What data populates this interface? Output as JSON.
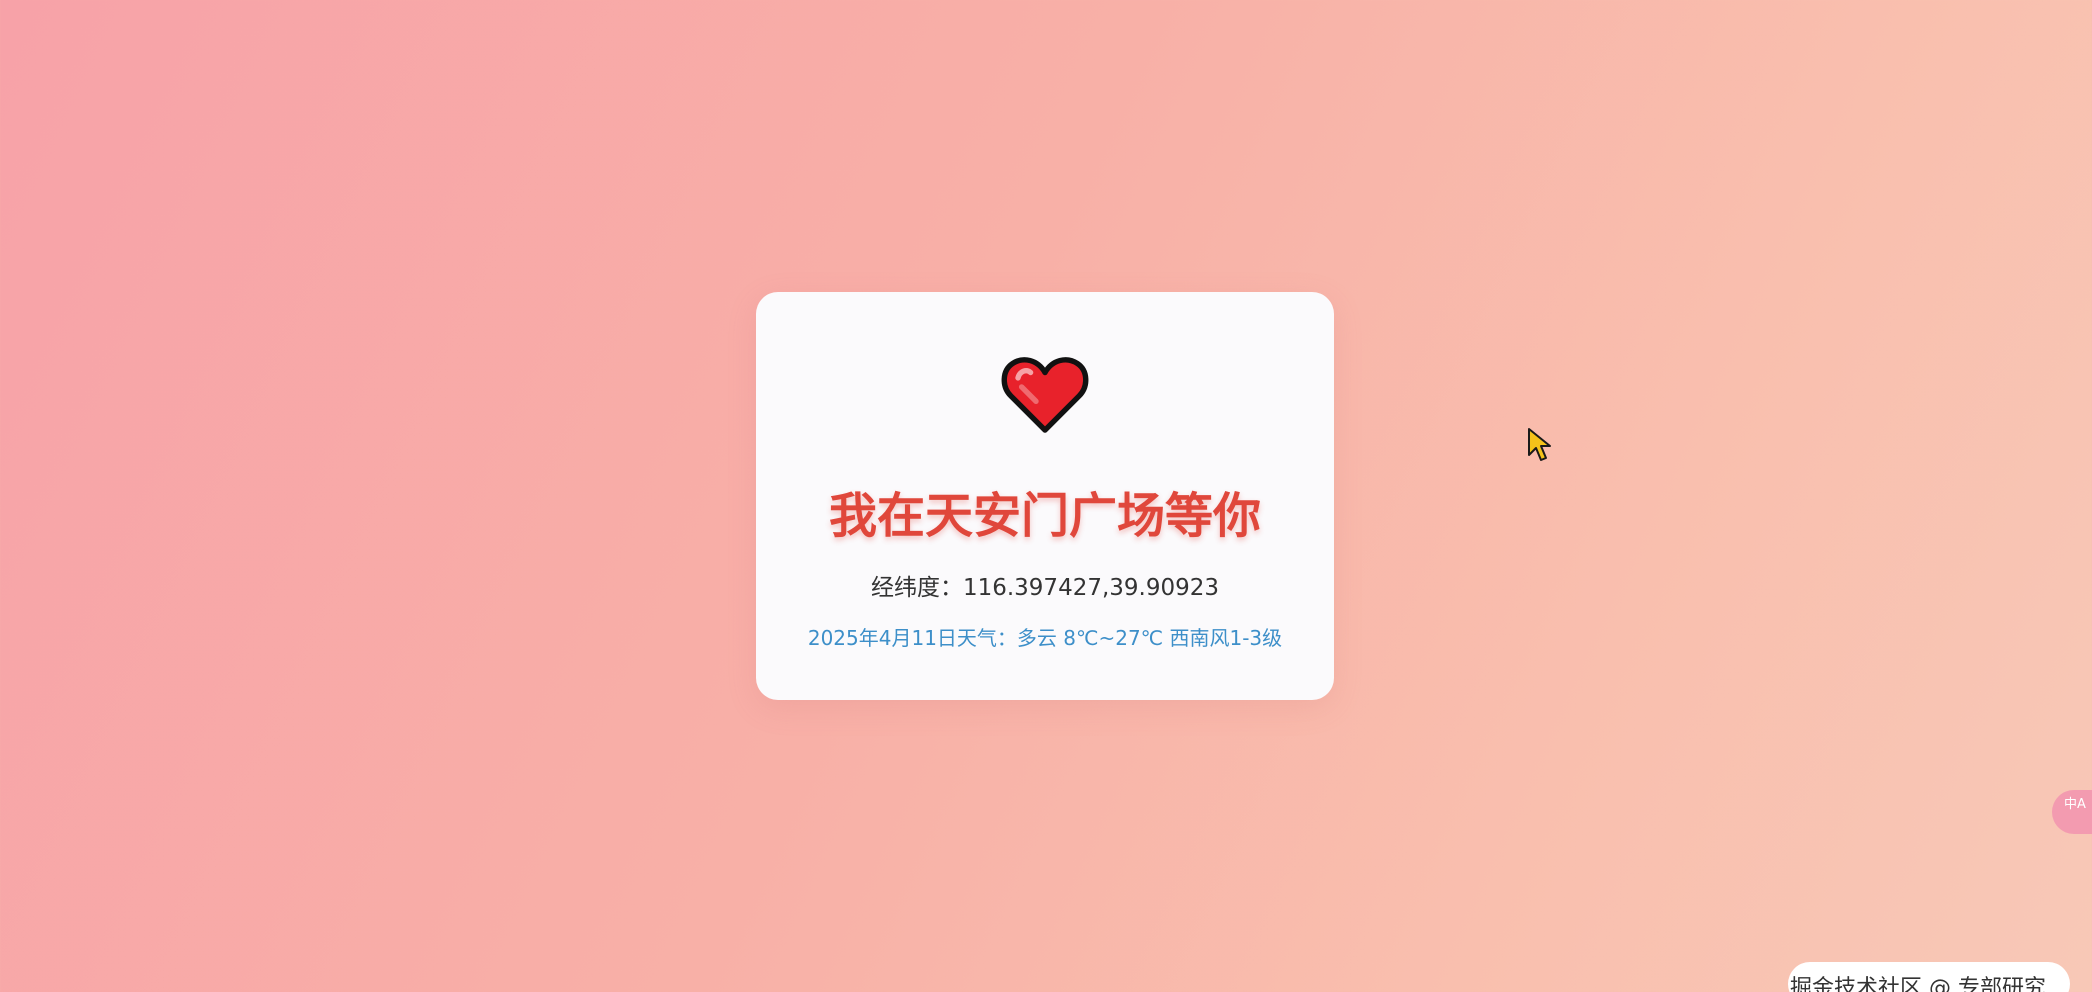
{
  "card": {
    "heart_icon": "red-heart-icon",
    "title": "我在天安门广场等你",
    "coordinates": "经纬度：116.397427,39.90923",
    "weather": "2025年4月11日天气：多云 8℃~27℃ 西南风1-3级"
  },
  "translate_button": {
    "icon": "translate-icon",
    "label": "中A"
  },
  "watermark": {
    "text": "掘金技术社区 @ 专部研究"
  },
  "colors": {
    "title": "#e0473b",
    "weather": "#3d8fc9",
    "heart": "#e8222b",
    "background_start": "#f7a2a8",
    "background_end": "#f8c8b7"
  }
}
